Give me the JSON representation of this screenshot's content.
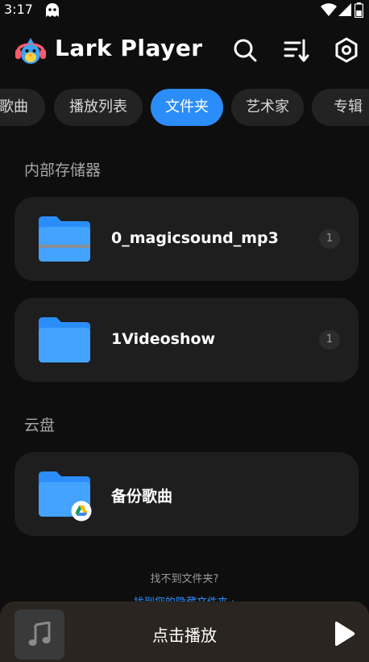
{
  "status_bar": {
    "time": "3:17",
    "icons": [
      "ghost-icon",
      "wifi-icon",
      "signal-icon",
      "battery-icon"
    ]
  },
  "header": {
    "title": "Lark Player",
    "actions": [
      "search-icon",
      "sort-icon",
      "settings-icon"
    ]
  },
  "tabs": [
    {
      "label": "歌曲",
      "active": false
    },
    {
      "label": "播放列表",
      "active": false
    },
    {
      "label": "文件夹",
      "active": true
    },
    {
      "label": "艺术家",
      "active": false
    },
    {
      "label": "专辑",
      "active": false
    }
  ],
  "internal_storage": {
    "title": "内部存储器",
    "folders": [
      {
        "name": "0_magicsound_mp3",
        "count": "1"
      },
      {
        "name": "1Videoshow",
        "count": "1"
      }
    ]
  },
  "cloud": {
    "title": "云盘",
    "folders": [
      {
        "name": "备份歌曲",
        "icon": "google-drive-icon"
      }
    ]
  },
  "hint": "找不到文件夹?",
  "hidden_folders_link": "找到您的隐藏文件夹 ›",
  "player": {
    "label": "点击播放"
  },
  "colors": {
    "accent": "#2b8dfa",
    "background": "#0e0e0e",
    "card": "#1e1e1e",
    "player_bar": "#2a2520"
  }
}
